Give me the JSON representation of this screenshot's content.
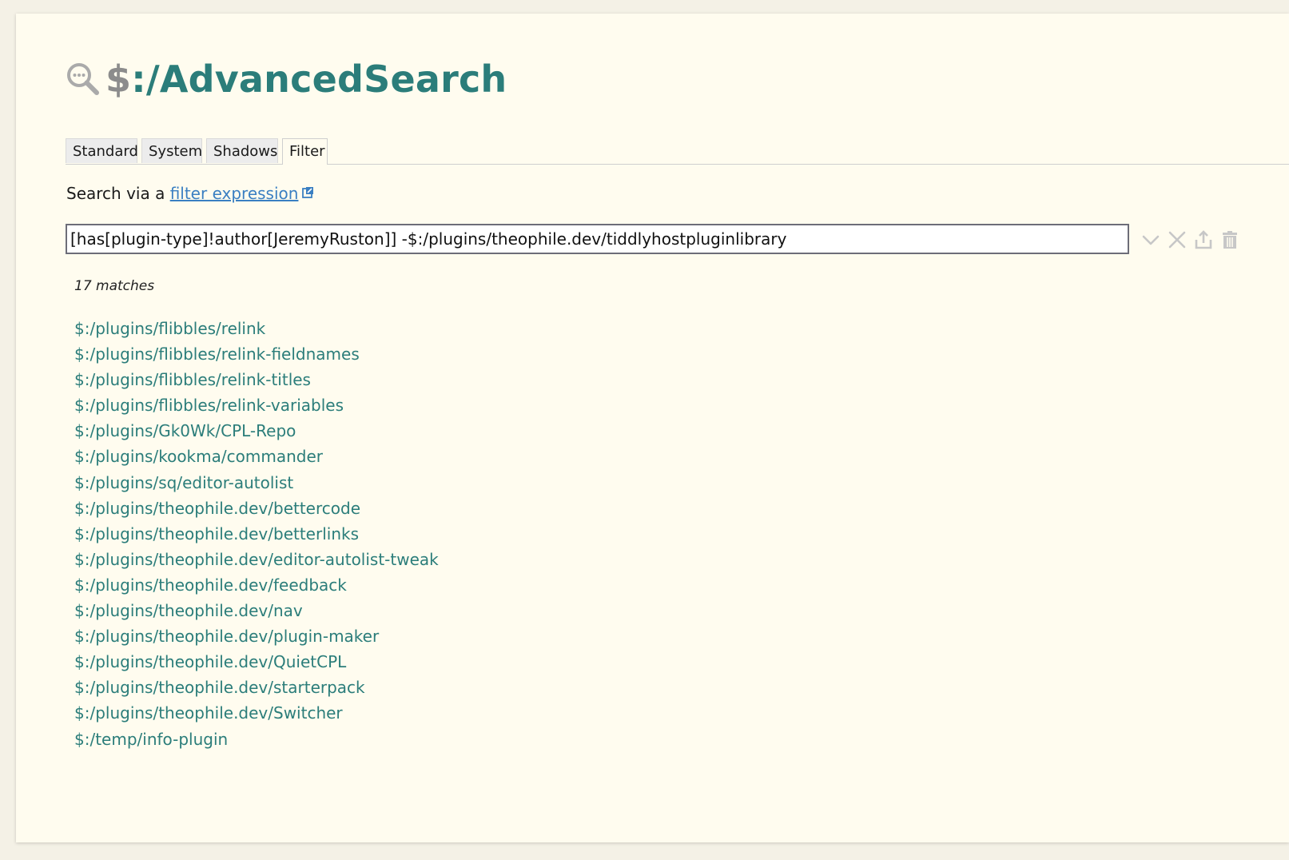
{
  "title": {
    "prefix": "$",
    "rest": ":/AdvancedSearch",
    "icon": "advanced-search-icon"
  },
  "tabs": [
    {
      "label": "Standard",
      "active": false
    },
    {
      "label": "System",
      "active": false
    },
    {
      "label": "Shadows",
      "active": false
    },
    {
      "label": "Filter",
      "active": true
    }
  ],
  "filter": {
    "intro_text": "Search via a ",
    "link_text": "filter expression",
    "value": "[has[plugin-type]!author[JeremyRuston]] -$:/plugins/theophile.dev/tiddlyhostpluginlibrary",
    "buttons": [
      "chevron-down-icon",
      "close-icon",
      "export-icon",
      "delete-icon"
    ]
  },
  "results": {
    "count_text": "17 matches",
    "items": [
      "$:/plugins/flibbles/relink",
      "$:/plugins/flibbles/relink-fieldnames",
      "$:/plugins/flibbles/relink-titles",
      "$:/plugins/flibbles/relink-variables",
      "$:/plugins/Gk0Wk/CPL-Repo",
      "$:/plugins/kookma/commander",
      "$:/plugins/sq/editor-autolist",
      "$:/plugins/theophile.dev/bettercode",
      "$:/plugins/theophile.dev/betterlinks",
      "$:/plugins/theophile.dev/editor-autolist-tweak",
      "$:/plugins/theophile.dev/feedback",
      "$:/plugins/theophile.dev/nav",
      "$:/plugins/theophile.dev/plugin-maker",
      "$:/plugins/theophile.dev/QuietCPL",
      "$:/plugins/theophile.dev/starterpack",
      "$:/plugins/theophile.dev/Switcher",
      "$:/temp/info-plugin"
    ]
  },
  "colors": {
    "page_bg": "#f4f1e6",
    "tiddler_bg": "#fffcef",
    "link": "#2b7d7a",
    "external_link": "#3a7fc2",
    "icon_muted": "#c7c7c7"
  }
}
